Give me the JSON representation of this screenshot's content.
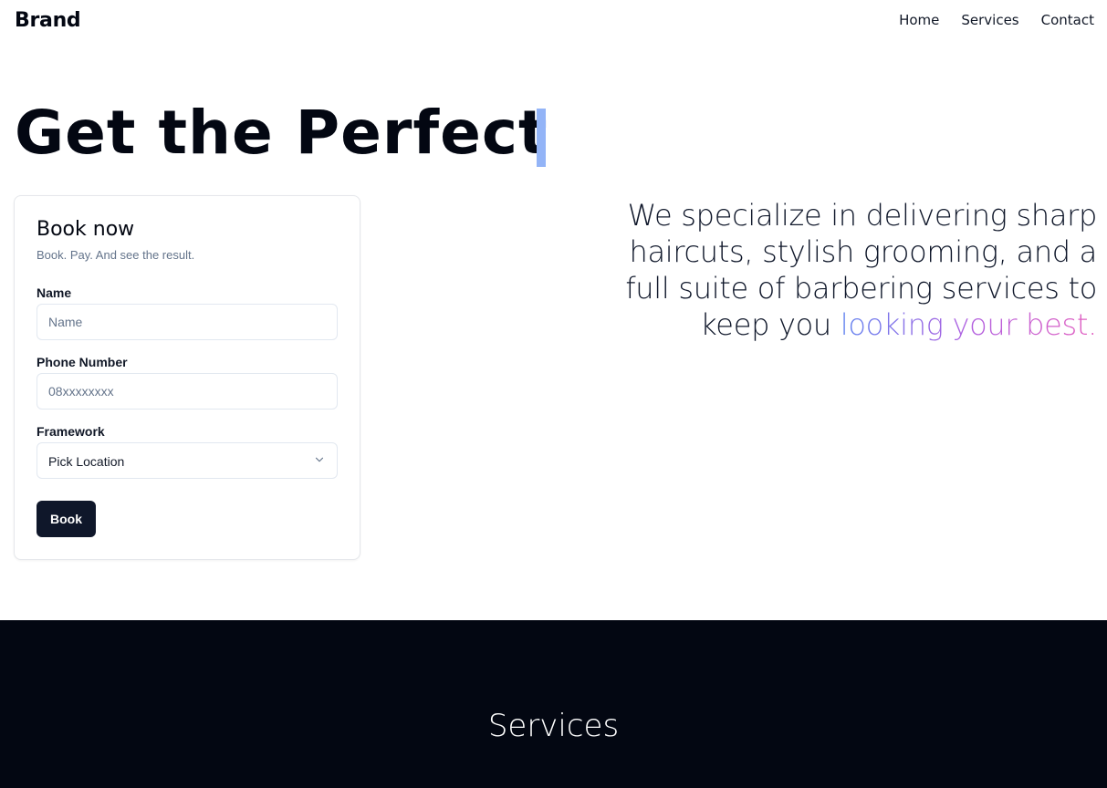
{
  "nav": {
    "brand": "Brand",
    "links": [
      "Home",
      "Services",
      "Contact"
    ]
  },
  "hero": {
    "title": "Get the Perfect",
    "tagline_main": "We specialize in delivering sharp haircuts, stylish grooming, and a full suite of barbering services to keep you ",
    "tagline_highlight": "looking your best."
  },
  "booking": {
    "title": "Book now",
    "subtitle": "Book. Pay. And see the result.",
    "name_label": "Name",
    "name_placeholder": "Name",
    "phone_label": "Phone Number",
    "phone_placeholder": "08xxxxxxxx",
    "framework_label": "Framework",
    "framework_value": "Pick Location",
    "submit_label": "Book"
  },
  "services": {
    "title": "Services"
  },
  "colors": {
    "primary_dark": "#0f172a",
    "section_bg": "#030712",
    "cursor": "#93b4f7",
    "gradient": [
      "#6184f0",
      "#b160e0",
      "#e35fbf"
    ]
  },
  "icons": {
    "select_chevron": "chevron-down-icon"
  }
}
